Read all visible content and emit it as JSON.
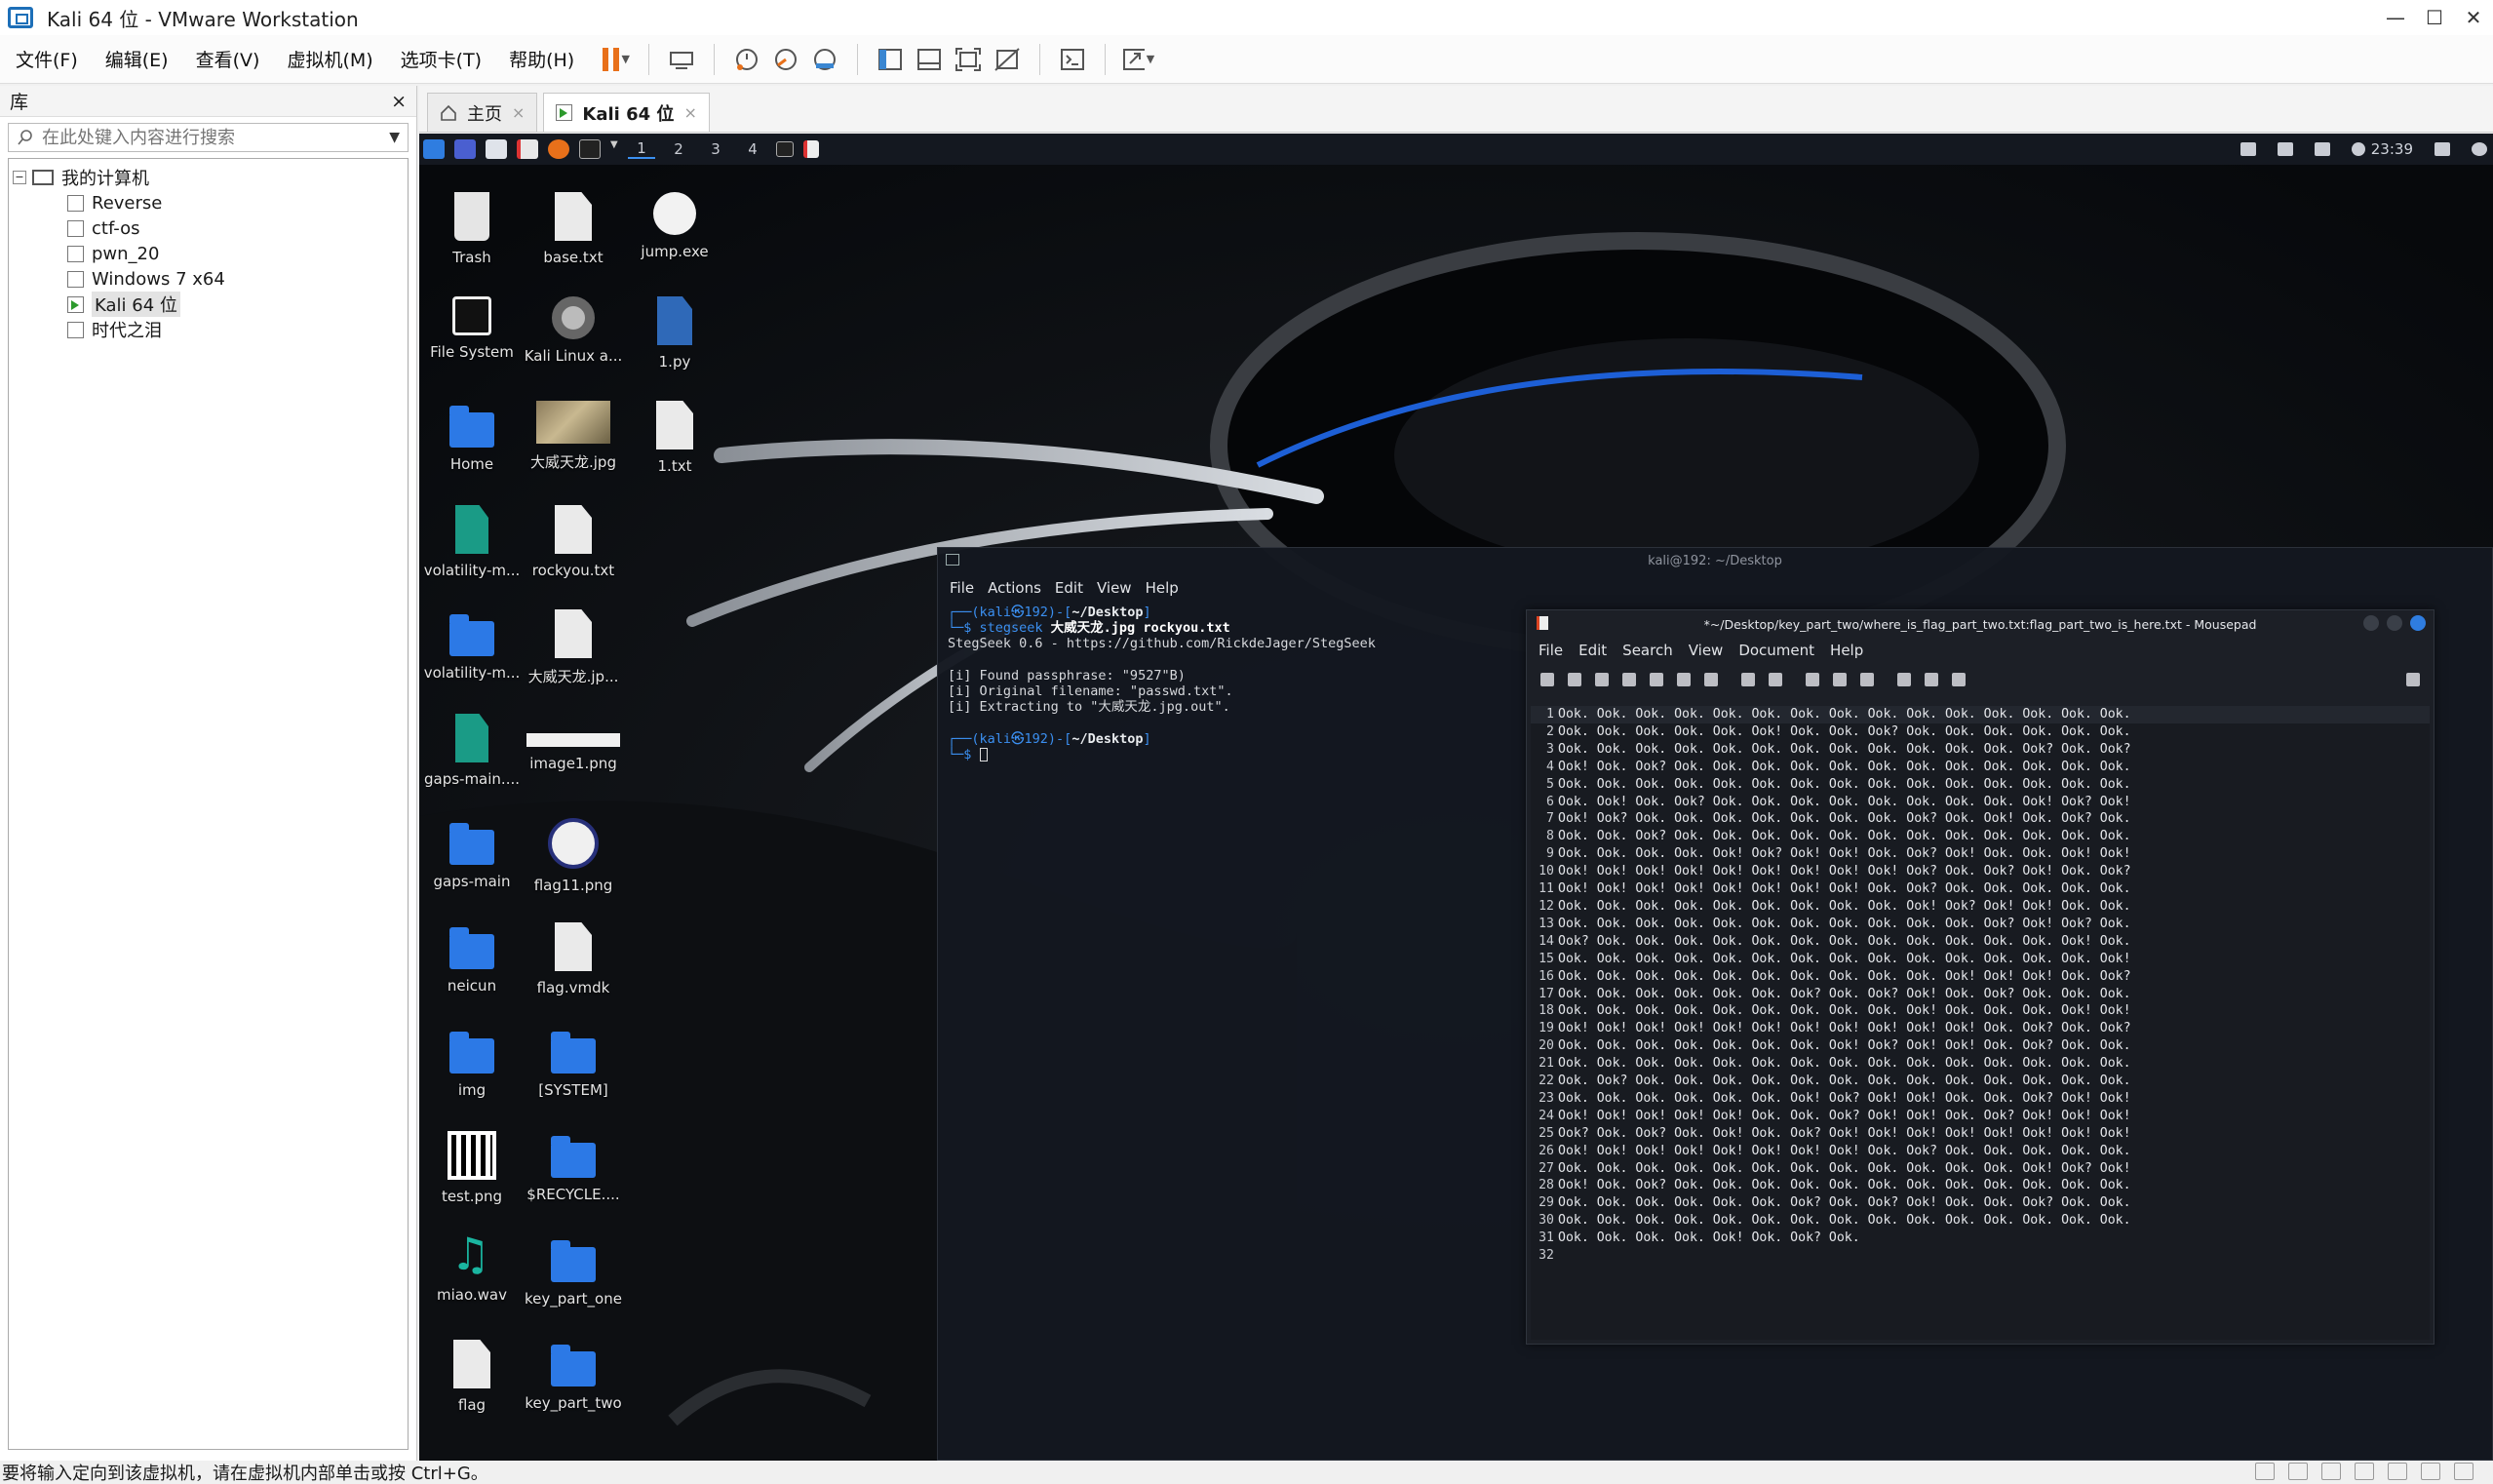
{
  "window": {
    "title": "Kali 64 位 - VMware Workstation",
    "controls": {
      "minimize": "—",
      "maximize": "☐",
      "close": "✕"
    }
  },
  "menubar": {
    "items": [
      "文件(F)",
      "编辑(E)",
      "查看(V)",
      "虚拟机(M)",
      "选项卡(T)",
      "帮助(H)"
    ]
  },
  "library": {
    "title": "库",
    "close": "×",
    "search_placeholder": "在此处键入内容进行搜索",
    "root": "我的计算机",
    "vms": [
      "Reverse",
      "ctf-os",
      "pwn_20",
      "Windows 7 x64",
      "Kali 64 位",
      "时代之泪"
    ],
    "selected_index": 4
  },
  "tabs": [
    {
      "label": "主页",
      "close": "×"
    },
    {
      "label": "Kali 64 位",
      "close": "×"
    }
  ],
  "status_text": "要将输入定向到该虚拟机，请在虚拟机内部单击或按 Ctrl+G。",
  "guest": {
    "panel": {
      "workspaces": [
        "1",
        "2",
        "3",
        "4"
      ],
      "active_workspace": 0,
      "time": "23:39"
    },
    "desktop_icons": [
      {
        "label": "Trash",
        "type": "trash"
      },
      {
        "label": "base.txt",
        "type": "doc"
      },
      {
        "label": "jump.exe",
        "type": "gear"
      },
      {
        "label": "File System",
        "type": "fs"
      },
      {
        "label": "Kali Linux a...",
        "type": "disc"
      },
      {
        "label": "1.py",
        "type": "py"
      },
      {
        "label": "Home",
        "type": "folder"
      },
      {
        "label": "大威天龙.jpg",
        "type": "photo"
      },
      {
        "label": "1.txt",
        "type": "doc"
      },
      {
        "label": "volatility-m...",
        "type": "zip"
      },
      {
        "label": "rockyou.txt",
        "type": "doc"
      },
      {
        "label": "volatility-m...",
        "type": "folder"
      },
      {
        "label": "大威天龙.jp...",
        "type": "doc"
      },
      {
        "label": "gaps-main....",
        "type": "zip"
      },
      {
        "label": "image1.png",
        "type": "white"
      },
      {
        "label": "gaps-main",
        "type": "folder"
      },
      {
        "label": "flag11.png",
        "type": "badge"
      },
      {
        "label": "neicun",
        "type": "folder"
      },
      {
        "label": "flag.vmdk",
        "type": "doc"
      },
      {
        "label": "img",
        "type": "folder"
      },
      {
        "label": "[SYSTEM]",
        "type": "folder"
      },
      {
        "label": "test.png",
        "type": "qr"
      },
      {
        "label": "$RECYCLE....",
        "type": "folder"
      },
      {
        "label": "miao.wav",
        "type": "music"
      },
      {
        "label": "key_part_one",
        "type": "folder"
      },
      {
        "label": "flag",
        "type": "doc"
      },
      {
        "label": "key_part_two",
        "type": "folder"
      }
    ],
    "terminal": {
      "title": "kali@192: ~/Desktop",
      "menu": [
        "File",
        "Actions",
        "Edit",
        "View",
        "Help"
      ],
      "prompt_user": "kali㉿192",
      "prompt_path": "~/Desktop",
      "command": "stegseek",
      "command_args": " 大威天龙.jpg rockyou.txt",
      "output": [
        "StegSeek 0.6 - https://github.com/RickdeJager/StegSeek",
        "",
        "[i] Found passphrase: \"9527\"B)",
        "[i] Original filename: \"passwd.txt\".",
        "[i] Extracting to \"大威天龙.jpg.out\"."
      ]
    },
    "mousepad": {
      "title": "*~/Desktop/key_part_two/where_is_flag_part_two.txt:flag_part_two_is_here.txt - Mousepad",
      "menu": [
        "File",
        "Edit",
        "Search",
        "View",
        "Document",
        "Help"
      ],
      "lines": [
        "Ook. Ook. Ook. Ook. Ook. Ook. Ook. Ook. Ook. Ook. Ook. Ook. Ook. Ook. Ook.",
        "Ook. Ook. Ook. Ook. Ook. Ook! Ook. Ook. Ook? Ook. Ook. Ook. Ook. Ook. Ook.",
        "Ook. Ook. Ook. Ook. Ook. Ook. Ook. Ook. Ook. Ook. Ook. Ook. Ook? Ook. Ook?",
        "Ook! Ook. Ook? Ook. Ook. Ook. Ook. Ook. Ook. Ook. Ook. Ook. Ook. Ook. Ook.",
        "Ook. Ook. Ook. Ook. Ook. Ook. Ook. Ook. Ook. Ook. Ook. Ook. Ook. Ook. Ook.",
        "Ook. Ook! Ook. Ook? Ook. Ook. Ook. Ook. Ook. Ook. Ook. Ook. Ook! Ook? Ook!",
        "Ook! Ook? Ook. Ook. Ook. Ook. Ook. Ook. Ook. Ook? Ook. Ook! Ook. Ook? Ook.",
        "Ook. Ook. Ook? Ook. Ook. Ook. Ook. Ook. Ook. Ook. Ook. Ook. Ook. Ook. Ook.",
        "Ook. Ook. Ook. Ook. Ook! Ook? Ook! Ook! Ook. Ook? Ook! Ook. Ook. Ook! Ook!",
        "Ook! Ook! Ook! Ook! Ook! Ook! Ook! Ook! Ook! Ook? Ook. Ook? Ook! Ook. Ook?",
        "Ook! Ook! Ook! Ook! Ook! Ook! Ook! Ook! Ook. Ook? Ook. Ook. Ook. Ook. Ook.",
        "Ook. Ook. Ook. Ook. Ook. Ook. Ook. Ook. Ook. Ook! Ook? Ook! Ook! Ook. Ook.",
        "Ook. Ook. Ook. Ook. Ook. Ook. Ook. Ook. Ook. Ook. Ook. Ook? Ook! Ook? Ook.",
        "Ook? Ook. Ook. Ook. Ook. Ook. Ook. Ook. Ook. Ook. Ook. Ook. Ook. Ook! Ook.",
        "Ook. Ook. Ook. Ook. Ook. Ook. Ook. Ook. Ook. Ook. Ook. Ook. Ook. Ook. Ook!",
        "Ook. Ook. Ook. Ook. Ook. Ook. Ook. Ook. Ook. Ook. Ook! Ook! Ook! Ook. Ook?",
        "Ook. Ook. Ook. Ook. Ook. Ook. Ook? Ook. Ook? Ook! Ook. Ook? Ook. Ook. Ook.",
        "Ook. Ook. Ook. Ook. Ook. Ook. Ook. Ook. Ook. Ook! Ook. Ook. Ook. Ook! Ook!",
        "Ook! Ook! Ook! Ook! Ook! Ook! Ook! Ook! Ook! Ook! Ook! Ook. Ook? Ook. Ook?",
        "Ook. Ook. Ook. Ook. Ook. Ook. Ook. Ook! Ook? Ook! Ook! Ook. Ook? Ook. Ook.",
        "Ook. Ook. Ook. Ook. Ook. Ook. Ook. Ook. Ook. Ook. Ook. Ook. Ook. Ook. Ook.",
        "Ook. Ook? Ook. Ook. Ook. Ook. Ook. Ook. Ook. Ook. Ook. Ook. Ook. Ook. Ook.",
        "Ook. Ook. Ook. Ook. Ook. Ook. Ook! Ook? Ook! Ook! Ook. Ook. Ook? Ook! Ook!",
        "Ook! Ook! Ook! Ook! Ook! Ook. Ook. Ook? Ook! Ook! Ook. Ook? Ook! Ook! Ook!",
        "Ook? Ook. Ook? Ook. Ook! Ook. Ook? Ook! Ook! Ook! Ook! Ook! Ook! Ook! Ook!",
        "Ook! Ook! Ook! Ook! Ook! Ook! Ook! Ook! Ook. Ook? Ook. Ook. Ook. Ook. Ook.",
        "Ook. Ook. Ook. Ook. Ook. Ook. Ook. Ook. Ook. Ook. Ook. Ook. Ook! Ook? Ook!",
        "Ook! Ook. Ook? Ook. Ook. Ook. Ook. Ook. Ook. Ook. Ook. Ook. Ook. Ook. Ook.",
        "Ook. Ook. Ook. Ook. Ook. Ook. Ook? Ook. Ook? Ook! Ook. Ook. Ook? Ook. Ook.",
        "Ook. Ook. Ook. Ook. Ook. Ook. Ook. Ook. Ook. Ook. Ook. Ook. Ook. Ook. Ook.",
        "Ook. Ook. Ook. Ook. Ook! Ook. Ook? Ook.",
        ""
      ]
    }
  }
}
